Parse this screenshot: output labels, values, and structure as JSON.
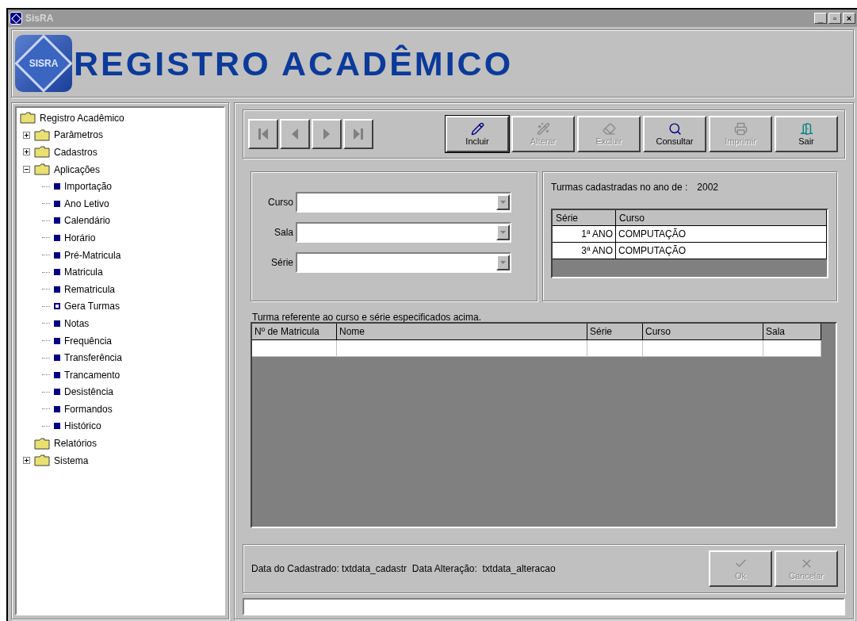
{
  "window": {
    "title": "SisRA",
    "controls": [
      "_",
      "▫",
      "×"
    ]
  },
  "header": {
    "logo_text": "SISRA",
    "title": "REGISTRO ACADÊMICO"
  },
  "tree": {
    "label": "Registro Acadêmico",
    "kind": "folder",
    "children": [
      {
        "label": "Parâmetros",
        "kind": "folder",
        "expandable": true,
        "expanded": false
      },
      {
        "label": "Cadastros",
        "kind": "folder",
        "expandable": true,
        "expanded": false
      },
      {
        "label": "Aplicações",
        "kind": "folder",
        "expandable": true,
        "expanded": true,
        "children": [
          {
            "label": "Importação",
            "kind": "item"
          },
          {
            "label": "Ano Letivo",
            "kind": "item"
          },
          {
            "label": "Calendário",
            "kind": "item"
          },
          {
            "label": "Horário",
            "kind": "item"
          },
          {
            "label": "Pré-Matricula",
            "kind": "item"
          },
          {
            "label": "Matricula",
            "kind": "item"
          },
          {
            "label": "Rematricula",
            "kind": "item"
          },
          {
            "label": "Gera Turmas",
            "kind": "item-hollow"
          },
          {
            "label": "Notas",
            "kind": "item"
          },
          {
            "label": "Frequência",
            "kind": "item"
          },
          {
            "label": "Transferência",
            "kind": "item"
          },
          {
            "label": "Trancamento",
            "kind": "item"
          },
          {
            "label": "Desistência",
            "kind": "item"
          },
          {
            "label": "Formandos",
            "kind": "item"
          },
          {
            "label": "Histórico",
            "kind": "item"
          }
        ]
      },
      {
        "label": "Relatórios",
        "kind": "folder",
        "expandable": false
      },
      {
        "label": "Sistema",
        "kind": "folder",
        "expandable": true,
        "expanded": false
      }
    ]
  },
  "nav_buttons": [
    {
      "kind": "first"
    },
    {
      "kind": "prev"
    },
    {
      "kind": "next"
    },
    {
      "kind": "last"
    }
  ],
  "toolbar": [
    {
      "label": "Incluir",
      "kind": "add",
      "disabled": false,
      "focused": true
    },
    {
      "label": "Alterar",
      "kind": "edit",
      "disabled": true,
      "focused": false
    },
    {
      "label": "Excluir",
      "kind": "delete",
      "disabled": true,
      "focused": false
    },
    {
      "label": "Consultar",
      "kind": "search",
      "disabled": false,
      "focused": false
    },
    {
      "label": "Imprimir",
      "kind": "print",
      "disabled": true,
      "focused": false
    },
    {
      "label": "Sair",
      "kind": "exit",
      "disabled": false,
      "focused": false
    }
  ],
  "filters": [
    {
      "label": "Curso"
    },
    {
      "label": "Sala"
    },
    {
      "label": "Série"
    }
  ],
  "classes": {
    "caption": "Turmas cadastradas no ano de :",
    "year": "2002",
    "columns": [
      "Série",
      "Curso"
    ],
    "rows": [
      [
        "1ª ANO",
        "COMPUTAÇÃO"
      ],
      [
        "3ª ANO",
        "COMPUTAÇÃO"
      ]
    ]
  },
  "students": {
    "caption": "Turma referente ao curso e série especificados acima.",
    "columns": [
      "Nº de Matricula",
      "Nome",
      "Série",
      "Curso",
      "Sala"
    ]
  },
  "footer": {
    "text": "Data do Cadastrado: txtdata_cadastr  Data Alteração:  txtdata_alteracao",
    "buttons": [
      {
        "label": "Ok",
        "kind": "ok",
        "disabled": true
      },
      {
        "label": "Cancelar",
        "kind": "cancel",
        "disabled": true
      }
    ]
  }
}
